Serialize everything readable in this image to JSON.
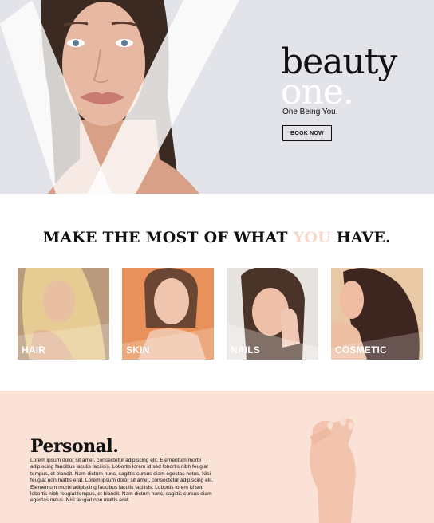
{
  "hero": {
    "brand_line1": "beauty",
    "brand_line2": "one.",
    "tagline": "One Being You.",
    "book_button": "BOOK NOW",
    "background_color": "#e3e4e9"
  },
  "services": {
    "title_before": "MAKE THE MOST OF WHAT ",
    "title_accent": "YOU",
    "title_after": " HAVE.",
    "accent_color": "#f6d8cc",
    "cards": [
      {
        "label": "HAIR",
        "bg": "#b89a7d"
      },
      {
        "label": "SKIN",
        "bg": "#e8915a"
      },
      {
        "label": "NAILS",
        "bg": "#e7e3df"
      },
      {
        "label": "COSMETIC",
        "bg": "#e9c9a5"
      }
    ]
  },
  "personal": {
    "title": "Personal.",
    "body": "Lorem ipsum dolor sit amet, consectetur adipiscing elit. Elementum morbi adipiscing faucibus iaculis facilisis. Lobortis lorem id sed lobortis nibh feugiat tempus, et blandit. Nam dictum nunc, sagittis cursus diam egestas netus. Nisi feugiat non mattis erat. Lorem ipsum dolor sit amet, consectetur adipiscing elit. Elementum morbi adipiscing faucibus iaculis facilisis. Lobortis lorem id sed lobortis nibh feugiat tempus, et blandit. Nam dictum nunc, sagittis cursus diam egestas netus. Nisi feugiat non mattis erat.",
    "background_color": "#fbe2d7"
  }
}
